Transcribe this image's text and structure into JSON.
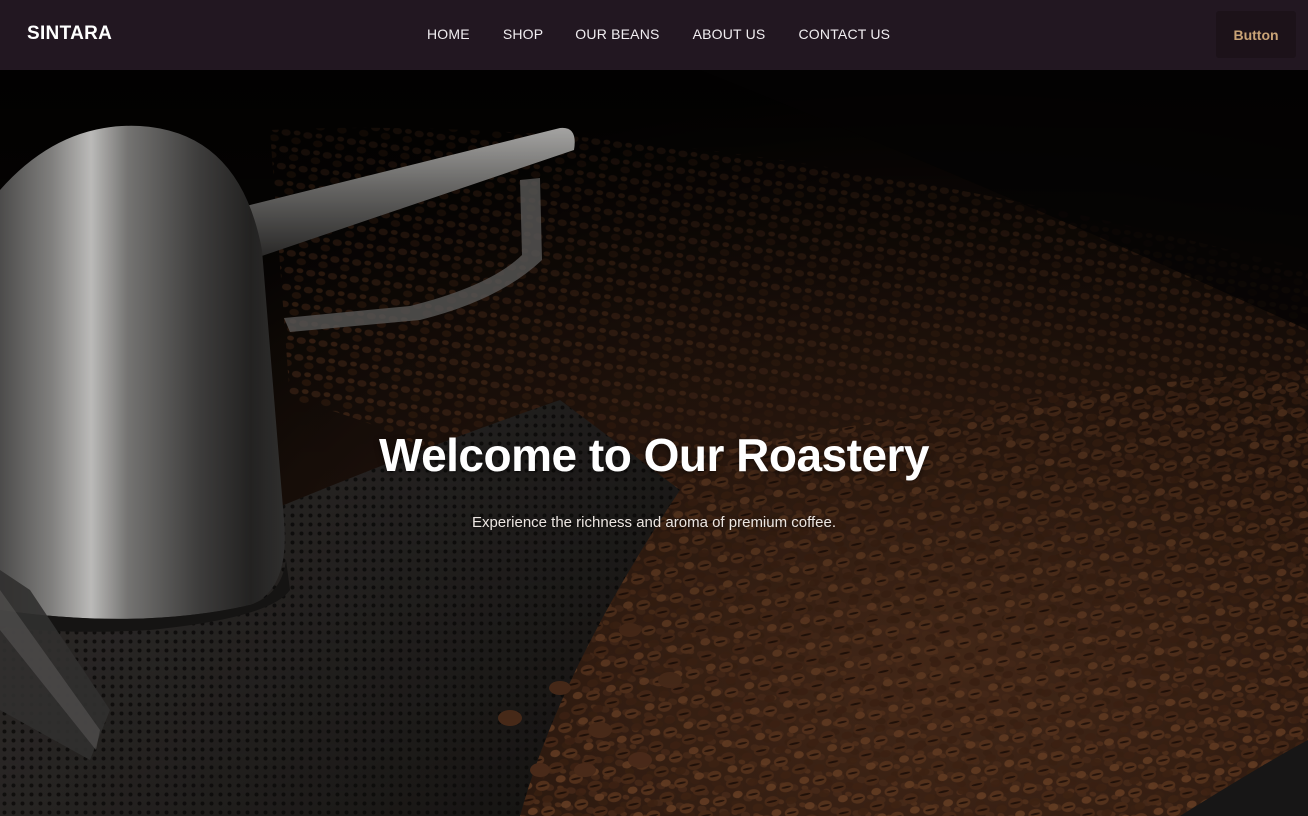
{
  "nav": {
    "brand": "SINTARA",
    "links": [
      {
        "label": "HOME"
      },
      {
        "label": "SHOP"
      },
      {
        "label": "OUR BEANS"
      },
      {
        "label": "ABOUT US"
      },
      {
        "label": "CONTACT US"
      }
    ],
    "button_label": "Button"
  },
  "hero": {
    "title": "Welcome to Our Roastery",
    "subtitle": "Experience the richness and aroma of premium coffee.",
    "image_subject": "coffee-beans-in-roaster-cooling-tray"
  },
  "colors": {
    "nav_background": "#221721",
    "nav_text": "#f1eef1",
    "button_text": "#c9a376",
    "button_background": "#1c1219"
  }
}
